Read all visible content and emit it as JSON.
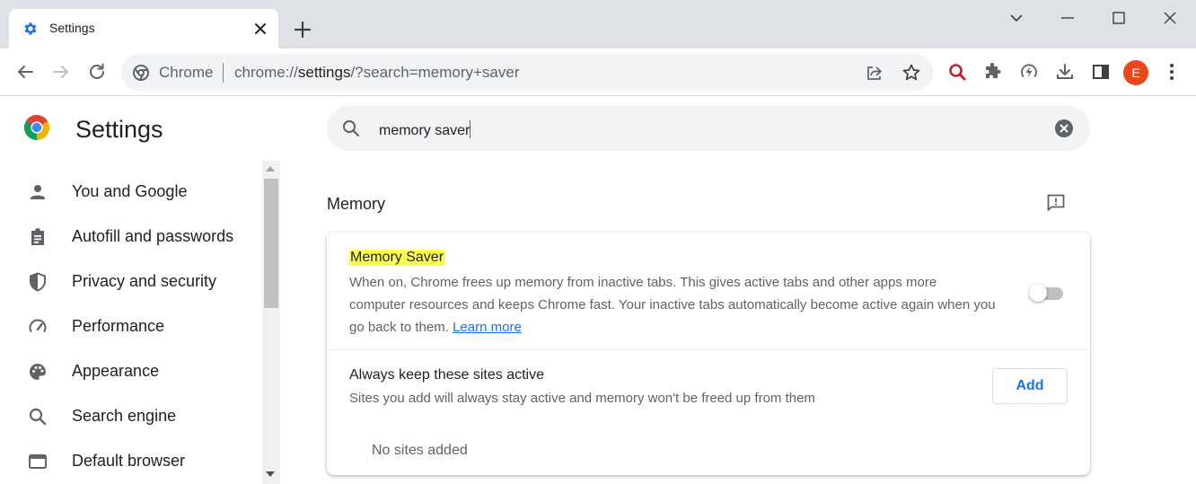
{
  "tab": {
    "title": "Settings",
    "icon": "gear-icon"
  },
  "omnibox": {
    "site_chip": "Chrome",
    "url_prefix": "chrome://",
    "url_host": "settings",
    "url_path": "/?search=memory+saver"
  },
  "avatar": {
    "initial": "E",
    "color": "#e8481c"
  },
  "settings": {
    "title": "Settings"
  },
  "search": {
    "value": "memory saver"
  },
  "sidebar": {
    "items": [
      {
        "label": "You and Google",
        "icon": "person-icon"
      },
      {
        "label": "Autofill and passwords",
        "icon": "clipboard-icon"
      },
      {
        "label": "Privacy and security",
        "icon": "shield-icon"
      },
      {
        "label": "Performance",
        "icon": "speedometer-icon"
      },
      {
        "label": "Appearance",
        "icon": "palette-icon"
      },
      {
        "label": "Search engine",
        "icon": "search-icon"
      },
      {
        "label": "Default browser",
        "icon": "browser-window-icon"
      }
    ]
  },
  "memory": {
    "section_title": "Memory",
    "saver_title": "Memory Saver",
    "saver_desc": "When on, Chrome frees up memory from inactive tabs. This gives active tabs and other apps more computer resources and keeps Chrome fast. Your inactive tabs automatically become active again when you go back to them.",
    "learn_more": "Learn more",
    "saver_enabled": false,
    "keep_title": "Always keep these sites active",
    "keep_desc": "Sites you add will always stay active and memory won't be freed up from them",
    "add_label": "Add",
    "no_sites": "No sites added"
  },
  "colors": {
    "accent": "#1a73e8",
    "highlight": "#ffff4d"
  }
}
